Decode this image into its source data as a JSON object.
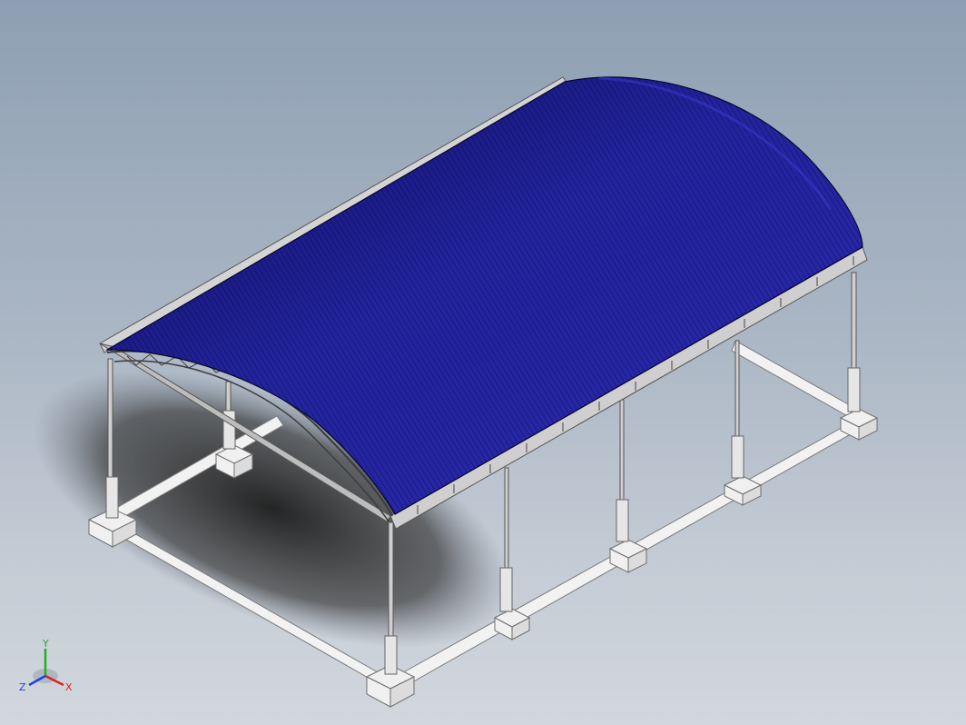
{
  "viewport": {
    "background_top": "#8e9fb3",
    "background_bottom": "#d2d7dd"
  },
  "model": {
    "roof_color": "#1a1a8c",
    "roof_line_color": "#0a0a44",
    "frame_color": "#e9e9e9",
    "column_color": "#d8d8d8",
    "shadow_color": "#2a2a2a"
  },
  "triad": {
    "x_label": "X",
    "y_label": "Y",
    "z_label": "Z",
    "x_color": "#e02020",
    "y_color": "#20b020",
    "z_color": "#2040e0"
  }
}
